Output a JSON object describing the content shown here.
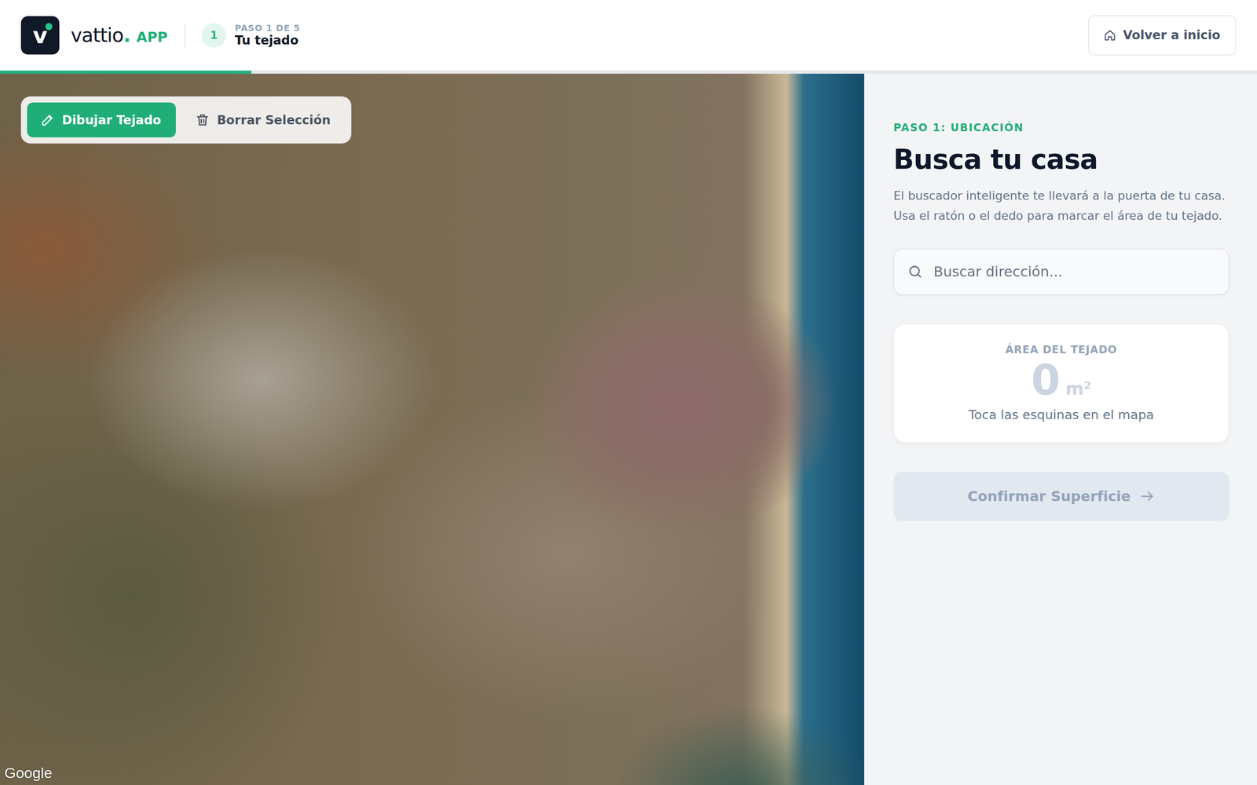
{
  "brand": {
    "icon_letter": "v",
    "name": "vattio",
    "dot": ".",
    "suffix": "APP"
  },
  "step": {
    "number": "1",
    "label": "PASO 1 DE 5",
    "title": "Tu tejado"
  },
  "home_button": "Volver a inicio",
  "progress": {
    "level": 0.2
  },
  "map": {
    "tools": [
      {
        "label": "Dibujar Tejado",
        "selected": true
      },
      {
        "label": "Borrar Selección",
        "selected": false
      }
    ],
    "attribution": "Google"
  },
  "panel": {
    "eyebrow": "PASO 1: UBICACIÓN",
    "title": "Busca tu casa",
    "description": "El buscador inteligente te llevará a la puerta de tu casa. Usa el ratón o el dedo para marcar el área de tu tejado.",
    "search": {
      "placeholder": "Buscar dirección..."
    },
    "area": {
      "label": "ÁREA DEL TEJADO",
      "value": "0",
      "unit": "m²",
      "hint": "Toca las esquinas en el mapa"
    },
    "confirm": {
      "label": "Confirmar Superficie",
      "disabled": true
    }
  }
}
